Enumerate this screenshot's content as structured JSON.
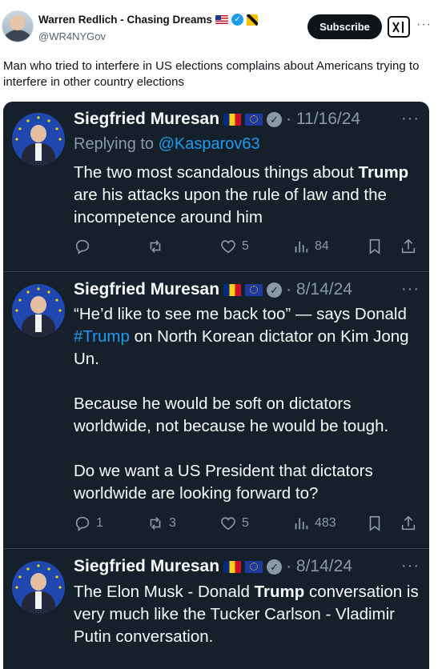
{
  "post": {
    "author_name": "Warren Redlich - Chasing Dreams",
    "author_handle": "@WR4NYGov",
    "subscribe_label": "Subscribe",
    "more_label": "···",
    "text": "Man who tried to interfere in US elections complains about Americans trying to interfere in other country elections"
  },
  "tweets": [
    {
      "name": "Siegfried Muresan",
      "date": "· 11/16/24",
      "reply_prefix": "Replying to ",
      "reply_mention": "@Kasparov63",
      "body_pre": "The two most scandalous things about ",
      "body_bold": "Trump",
      "body_post": " are his attacks upon the rule of law and the incompetence around him",
      "stats": {
        "replies": "",
        "reposts": "",
        "likes": "5",
        "views": "84"
      }
    },
    {
      "name": "Siegfried Muresan",
      "date": "· 8/14/24",
      "p1_pre": "“He’d like to see me back too” — says Donald ",
      "p1_tag": "#Trump",
      "p1_post": " on North Korean dictator on Kim Jong Un.",
      "p2": "Because he would be soft on dictators worldwide, not because he would be tough.",
      "p3": "Do we want a US President that dictators worldwide are looking forward to?",
      "stats": {
        "replies": "1",
        "reposts": "3",
        "likes": "5",
        "views": "483"
      }
    },
    {
      "name": "Siegfried Muresan",
      "date": "· 8/14/24",
      "body_pre": "The Elon Musk - Donald ",
      "body_bold": "Trump",
      "body_post": " conversation is very much like the Tucker Carlson - Vladimir Putin conversation."
    }
  ],
  "colors": {
    "dark_bg": "#15202b",
    "text_light": "#f7f9f9",
    "muted": "#8b98a5",
    "link_blue": "#1d9bf0"
  }
}
